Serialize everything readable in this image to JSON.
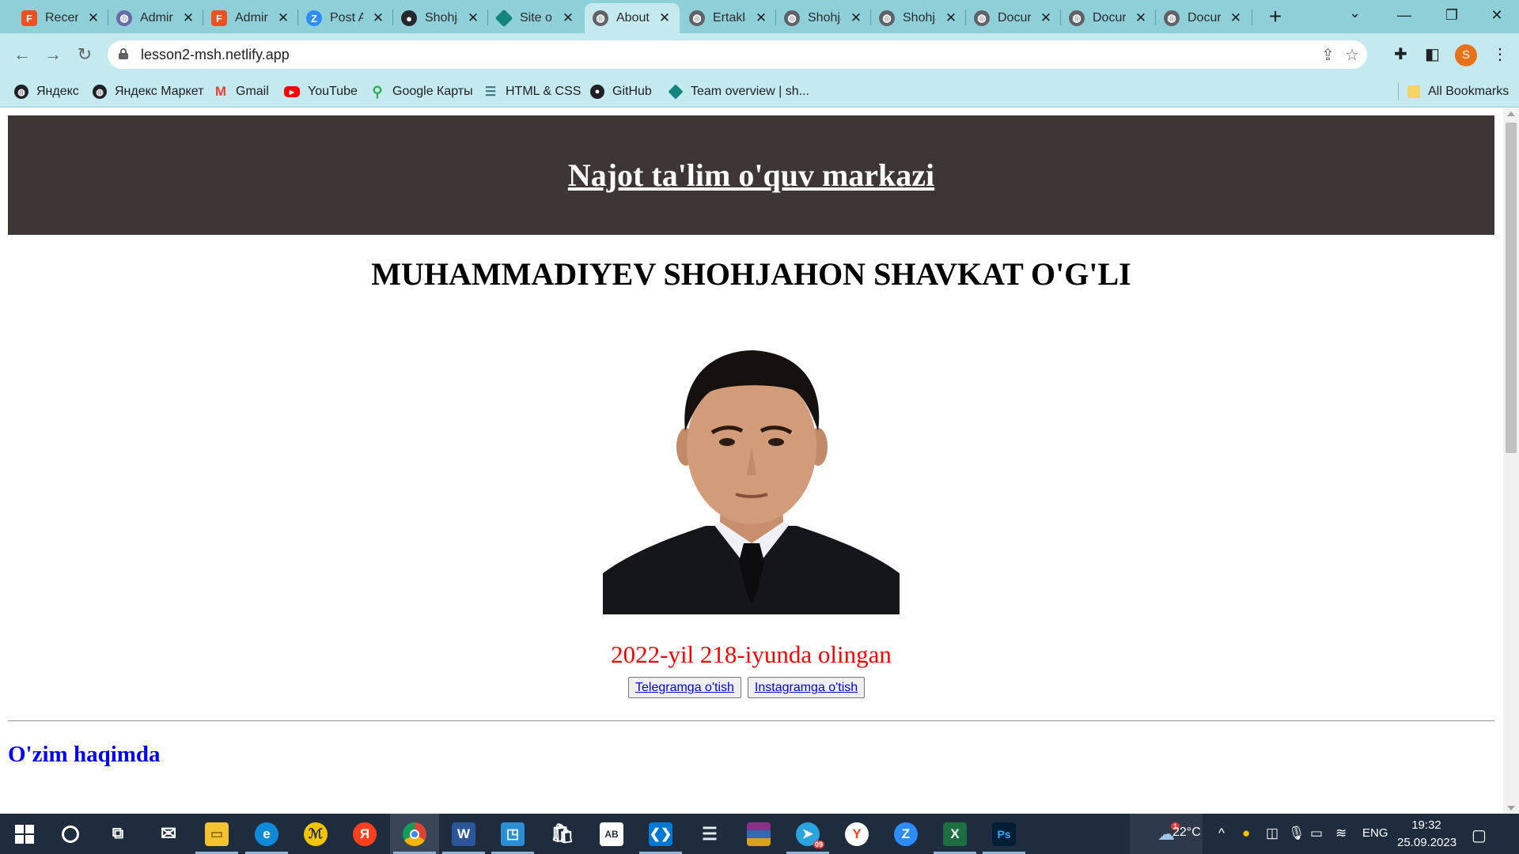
{
  "browser": {
    "tabs": [
      {
        "label": "Recen",
        "icon": "figma-icon",
        "color": "#f24e1e"
      },
      {
        "label": "Admir",
        "icon": "globe-icon",
        "color": "#6a6aa8"
      },
      {
        "label": "Admir",
        "icon": "figma-icon",
        "color": "#f24e1e"
      },
      {
        "label": "Post A",
        "icon": "z-icon",
        "color": "#2d8cff"
      },
      {
        "label": "Shohja",
        "icon": "github-icon",
        "color": "#24292e"
      },
      {
        "label": "Site o",
        "icon": "netlify-icon",
        "color": "#15847d"
      },
      {
        "label": "About",
        "icon": "globe-icon",
        "color": "#5f6368",
        "active": true
      },
      {
        "label": "Ertakla",
        "icon": "globe-icon",
        "color": "#5f6368"
      },
      {
        "label": "Shohja",
        "icon": "globe-icon",
        "color": "#5f6368"
      },
      {
        "label": "Shohja",
        "icon": "globe-icon",
        "color": "#5f6368"
      },
      {
        "label": "Docur",
        "icon": "globe-icon",
        "color": "#5f6368"
      },
      {
        "label": "Docur",
        "icon": "globe-icon",
        "color": "#5f6368"
      },
      {
        "label": "Docur",
        "icon": "globe-icon",
        "color": "#5f6368"
      }
    ],
    "url": "lesson2-msh.netlify.app",
    "profile_initial": "S",
    "bookmarks": [
      {
        "label": "Яндекс",
        "icon": "globe-icon"
      },
      {
        "label": "Яндекс Маркет",
        "icon": "globe-icon"
      },
      {
        "label": "Gmail",
        "icon": "gmail-icon"
      },
      {
        "label": "YouTube",
        "icon": "youtube-icon"
      },
      {
        "label": "Google Карты",
        "icon": "maps-pin-icon"
      },
      {
        "label": "HTML & CSS",
        "icon": "html-css-icon"
      },
      {
        "label": "GitHub",
        "icon": "github-icon"
      },
      {
        "label": "Team overview | sh...",
        "icon": "netlify-icon"
      }
    ],
    "all_bookmarks": "All Bookmarks"
  },
  "page": {
    "site_title": "Najot ta'lim o'quv markazi",
    "person_name": "MUHAMMADIYEV SHOHJAHON SHAVKAT O'G'LI",
    "photo_caption": "2022-yil 218-iyunda olingan",
    "telegram_button": "Telegramga o'tish",
    "instagram_button": "Instagramga o'tish",
    "section_heading": "O'zim haqimda",
    "colors": {
      "header_bg": "#3d3634",
      "caption": "#ff0000",
      "section_heading": "#0000ff",
      "link": "#0000ee"
    }
  },
  "taskbar": {
    "apps": [
      {
        "name": "start-button"
      },
      {
        "name": "search-button"
      },
      {
        "name": "task-view-button"
      },
      {
        "name": "mail-app"
      },
      {
        "name": "file-explorer-app"
      },
      {
        "name": "edge-app"
      },
      {
        "name": "app-yellow"
      },
      {
        "name": "yandex-browser-app"
      },
      {
        "name": "chrome-app"
      },
      {
        "name": "word-app"
      },
      {
        "name": "app-blue-square"
      },
      {
        "name": "microsoft-store-app"
      },
      {
        "name": "abbyy-app"
      },
      {
        "name": "vscode-app"
      },
      {
        "name": "layers-app"
      },
      {
        "name": "winrar-app"
      },
      {
        "name": "telegram-app"
      },
      {
        "name": "yandex-app"
      },
      {
        "name": "zoom-app"
      },
      {
        "name": "excel-app"
      },
      {
        "name": "photoshop-app"
      }
    ],
    "weather_badge": "1",
    "temperature": "22°C",
    "language": "ENG",
    "time": "19:32",
    "date": "25.09.2023",
    "telegram_badge": "09"
  }
}
